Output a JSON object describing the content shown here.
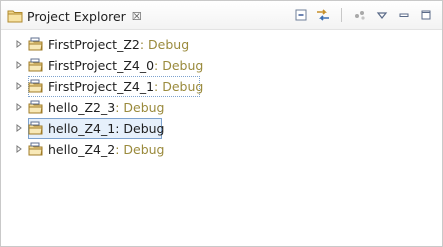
{
  "view": {
    "title": "Project Explorer",
    "close_glyph": "☒"
  },
  "toolbar": [
    {
      "name": "collapse-all-icon"
    },
    {
      "name": "link-with-editor-icon"
    },
    {
      "name": "focus-icon"
    },
    {
      "name": "view-menu-icon"
    },
    {
      "name": "minimize-icon"
    },
    {
      "name": "maximize-icon"
    }
  ],
  "projects": [
    {
      "name": "FirstProject_Z2",
      "config": ": Debug",
      "state": "normal"
    },
    {
      "name": "FirstProject_Z4_0",
      "config": ": Debug",
      "state": "normal"
    },
    {
      "name": "FirstProject_Z4_1",
      "config": ": Debug",
      "state": "focused"
    },
    {
      "name": "hello_Z2_3",
      "config": ": Debug",
      "state": "normal"
    },
    {
      "name": "hello_Z4_1",
      "config": ": Debug",
      "state": "selected"
    },
    {
      "name": "hello_Z4_2",
      "config": ": Debug",
      "state": "normal"
    }
  ],
  "colors": {
    "config_text": "#9a8a3c",
    "selection_border": "#7da2ce",
    "selection_fill": "#e6f0fb"
  }
}
